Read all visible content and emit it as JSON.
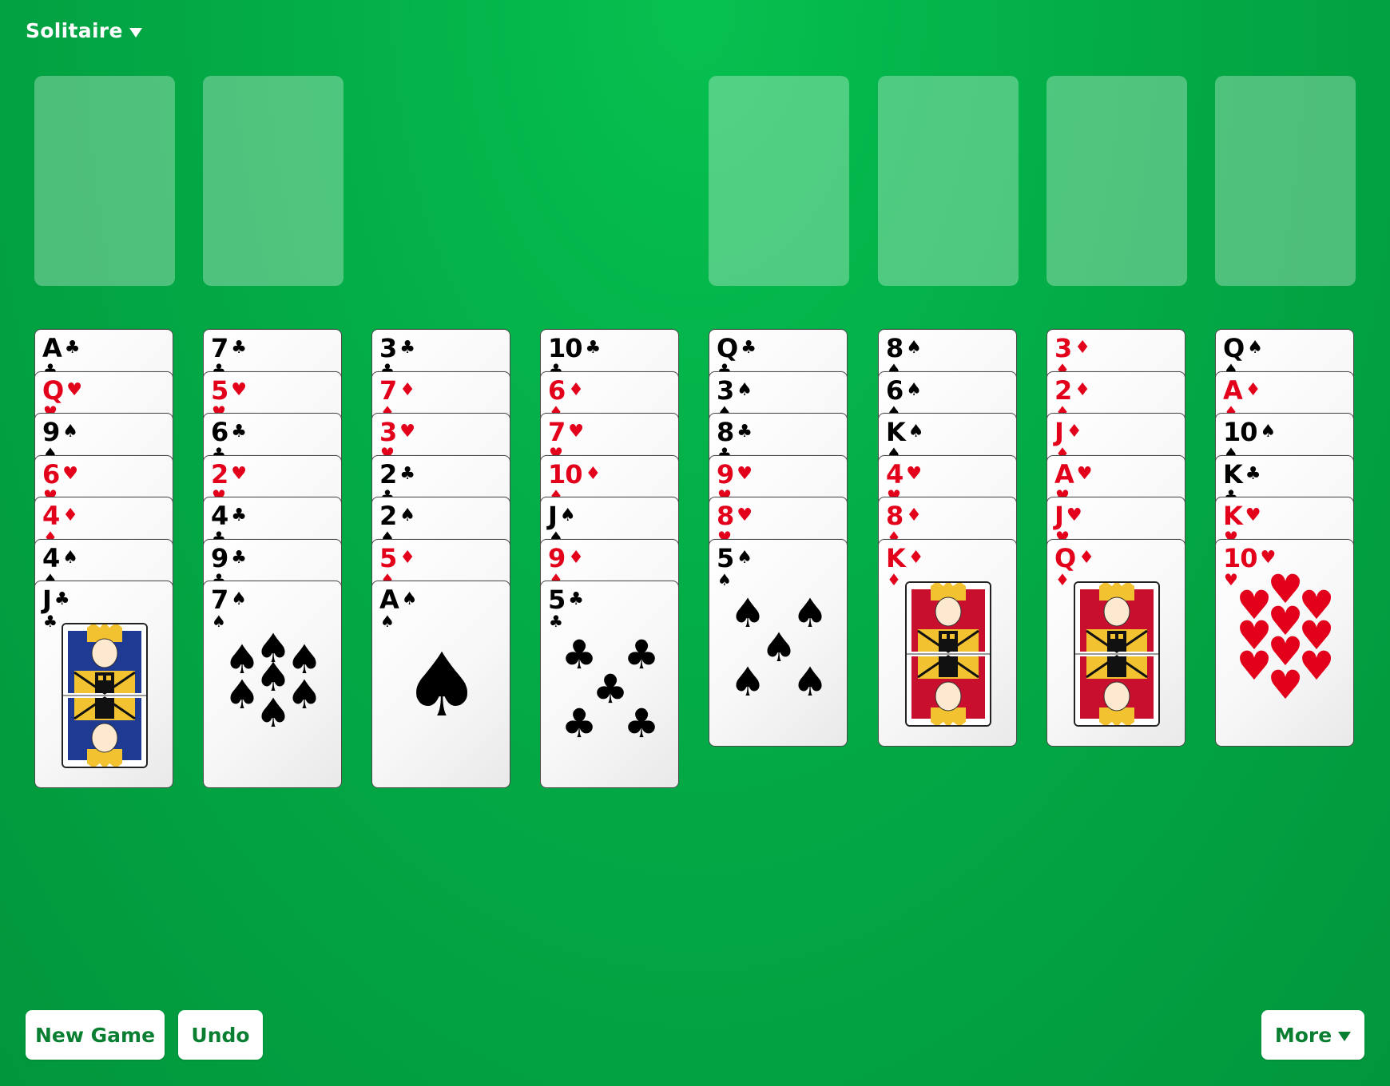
{
  "menu": {
    "title": "Solitaire"
  },
  "buttons": {
    "new_game": "New Game",
    "undo": "Undo",
    "more": "More"
  },
  "colors": {
    "felt": "#03ad47",
    "red": "#e2001b",
    "black": "#000000",
    "button_text": "#0a7f32"
  },
  "free_cells": 2,
  "foundations": 4,
  "tableau": [
    [
      {
        "r": "A",
        "s": "♣"
      },
      {
        "r": "Q",
        "s": "♥"
      },
      {
        "r": "9",
        "s": "♠"
      },
      {
        "r": "6",
        "s": "♥"
      },
      {
        "r": "4",
        "s": "♦"
      },
      {
        "r": "4",
        "s": "♠"
      },
      {
        "r": "J",
        "s": "♣"
      }
    ],
    [
      {
        "r": "7",
        "s": "♣"
      },
      {
        "r": "5",
        "s": "♥"
      },
      {
        "r": "6",
        "s": "♣"
      },
      {
        "r": "2",
        "s": "♥"
      },
      {
        "r": "4",
        "s": "♣"
      },
      {
        "r": "9",
        "s": "♣"
      },
      {
        "r": "7",
        "s": "♠"
      }
    ],
    [
      {
        "r": "3",
        "s": "♣"
      },
      {
        "r": "7",
        "s": "♦"
      },
      {
        "r": "3",
        "s": "♥"
      },
      {
        "r": "2",
        "s": "♣"
      },
      {
        "r": "2",
        "s": "♠"
      },
      {
        "r": "5",
        "s": "♦"
      },
      {
        "r": "A",
        "s": "♠"
      }
    ],
    [
      {
        "r": "10",
        "s": "♣"
      },
      {
        "r": "6",
        "s": "♦"
      },
      {
        "r": "7",
        "s": "♥"
      },
      {
        "r": "10",
        "s": "♦"
      },
      {
        "r": "J",
        "s": "♠"
      },
      {
        "r": "9",
        "s": "♦"
      },
      {
        "r": "5",
        "s": "♣"
      }
    ],
    [
      {
        "r": "Q",
        "s": "♣"
      },
      {
        "r": "3",
        "s": "♠"
      },
      {
        "r": "8",
        "s": "♣"
      },
      {
        "r": "9",
        "s": "♥"
      },
      {
        "r": "8",
        "s": "♥"
      },
      {
        "r": "5",
        "s": "♠"
      }
    ],
    [
      {
        "r": "8",
        "s": "♠"
      },
      {
        "r": "6",
        "s": "♠"
      },
      {
        "r": "K",
        "s": "♠"
      },
      {
        "r": "4",
        "s": "♥"
      },
      {
        "r": "8",
        "s": "♦"
      },
      {
        "r": "K",
        "s": "♦"
      }
    ],
    [
      {
        "r": "3",
        "s": "♦"
      },
      {
        "r": "2",
        "s": "♦"
      },
      {
        "r": "J",
        "s": "♦"
      },
      {
        "r": "A",
        "s": "♥"
      },
      {
        "r": "J",
        "s": "♥"
      },
      {
        "r": "Q",
        "s": "♦"
      }
    ],
    [
      {
        "r": "Q",
        "s": "♠"
      },
      {
        "r": "A",
        "s": "♦"
      },
      {
        "r": "10",
        "s": "♠"
      },
      {
        "r": "K",
        "s": "♣"
      },
      {
        "r": "K",
        "s": "♥"
      },
      {
        "r": "10",
        "s": "♥"
      }
    ]
  ]
}
